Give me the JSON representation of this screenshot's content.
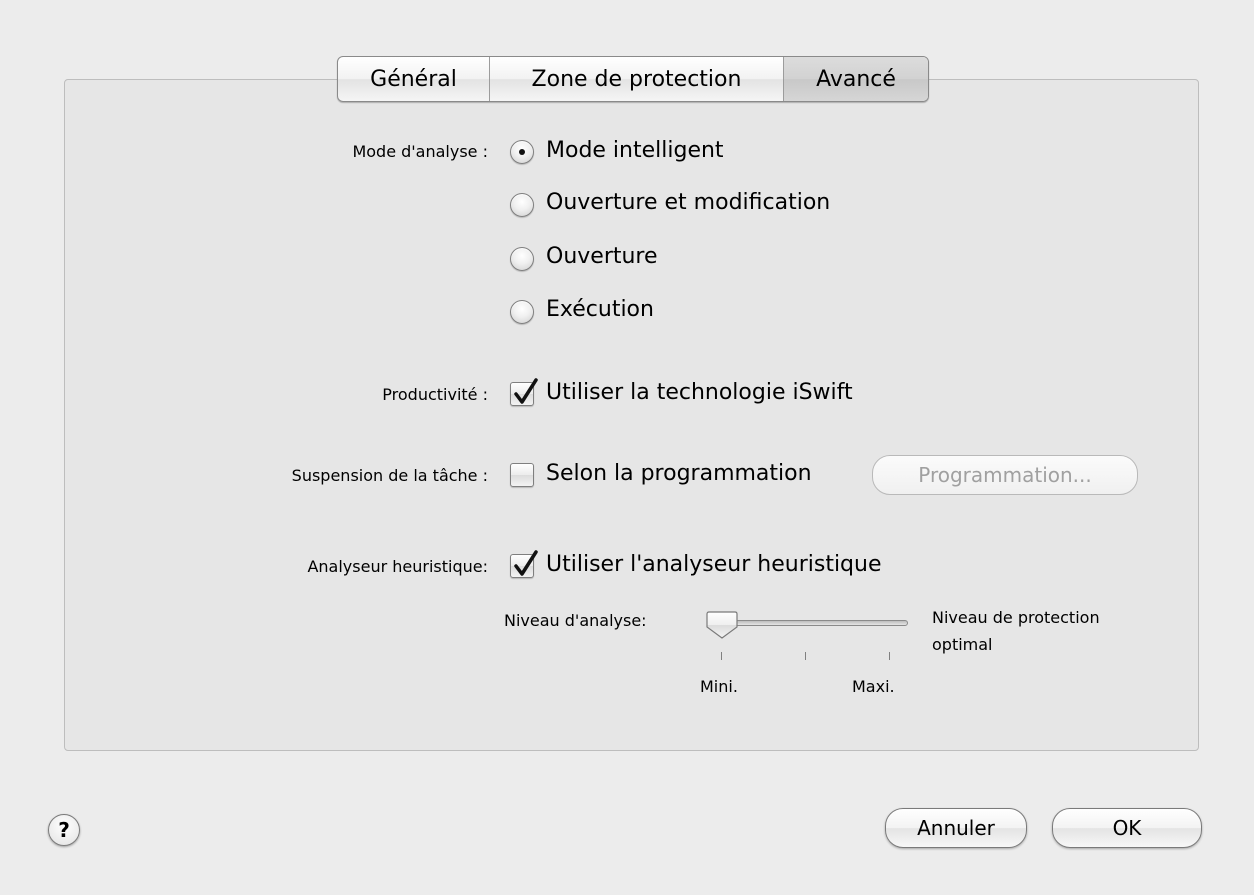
{
  "tabs": [
    {
      "label": "Général"
    },
    {
      "label": "Zone de protection"
    },
    {
      "label": "Avancé",
      "active": true
    }
  ],
  "scan_mode": {
    "label": "Mode d'analyse :",
    "options": [
      {
        "label": "Mode intelligent",
        "selected": true
      },
      {
        "label": "Ouverture et modification",
        "selected": false
      },
      {
        "label": "Ouverture",
        "selected": false
      },
      {
        "label": "Exécution",
        "selected": false
      }
    ]
  },
  "productivity": {
    "label": "Productivité :",
    "checkbox_label": "Utiliser la technologie iSwift",
    "checked": true
  },
  "suspension": {
    "label": "Suspension de la tâche :",
    "checkbox_label": "Selon la programmation",
    "checked": false,
    "button_label": "Programmation...",
    "button_enabled": false
  },
  "heuristic": {
    "label": "Analyseur heuristique:",
    "checkbox_label": "Utiliser l'analyseur heuristique",
    "checked": true,
    "level_label": "Niveau d'analyse:",
    "min_label": "Mini.",
    "max_label": "Maxi.",
    "level_description": [
      "Niveau de protection",
      "optimal"
    ],
    "slider_value": 0
  },
  "buttons": {
    "help": "?",
    "cancel": "Annuler",
    "ok": "OK"
  }
}
